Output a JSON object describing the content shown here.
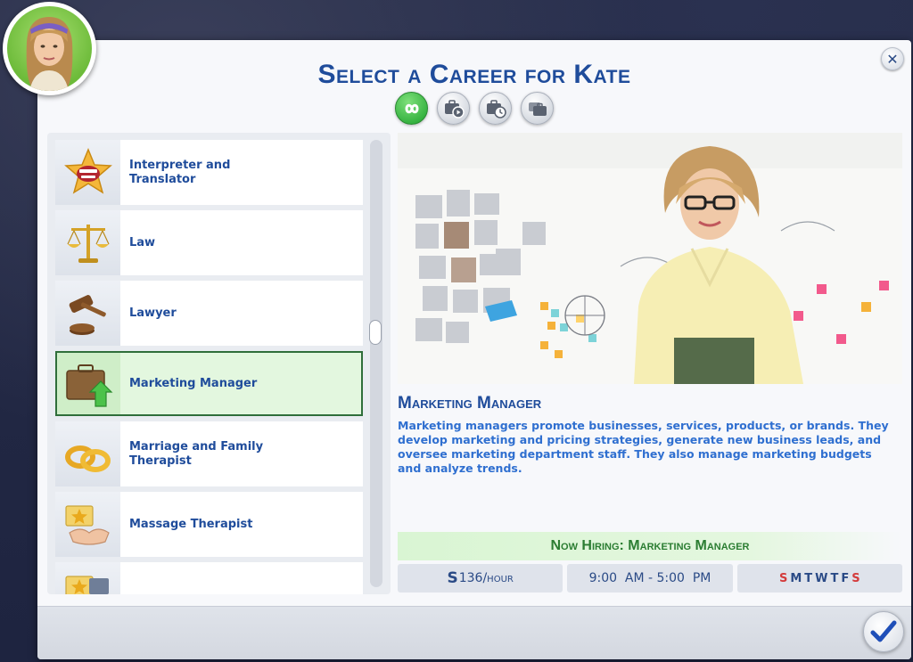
{
  "dialog": {
    "title": "Select a Career for Kate",
    "close_icon": "close-icon",
    "confirm_icon": "checkmark-icon"
  },
  "avatar": {
    "name": "Kate",
    "icon": "sim-portrait"
  },
  "filters": [
    {
      "name": "all-careers",
      "icon": "infinity-icon",
      "active": true
    },
    {
      "name": "active-careers",
      "icon": "briefcase-play-icon",
      "active": false
    },
    {
      "name": "part-time",
      "icon": "briefcase-clock-icon",
      "active": false
    },
    {
      "name": "freelance",
      "icon": "briefcase-stack-icon",
      "active": false
    }
  ],
  "careers": [
    {
      "label": "Interpreter and Translator",
      "icon": "star-mouth-icon"
    },
    {
      "label": "Law",
      "icon": "scales-icon"
    },
    {
      "label": "Lawyer",
      "icon": "gavel-icon"
    },
    {
      "label": "Marketing Manager",
      "icon": "briefcase-arrow-icon",
      "selected": true
    },
    {
      "label": "Marriage and Family Therapist",
      "icon": "rings-icon"
    },
    {
      "label": "Massage Therapist",
      "icon": "hands-star-icon"
    }
  ],
  "detail": {
    "title": "Marketing Manager",
    "description": "Marketing managers promote businesses, services, products, or brands. They develop marketing and pricing strategies, generate new business leads, and oversee marketing department staff. They also manage marketing budgets and analyze trends.",
    "hiring": "Now Hiring: Marketing Manager",
    "pay_symbol": "S",
    "pay_rate": "136/hour",
    "hours": "9:00  AM - 5:00  PM",
    "days": [
      {
        "letter": "S",
        "off": true
      },
      {
        "letter": "M",
        "off": false
      },
      {
        "letter": "T",
        "off": false
      },
      {
        "letter": "W",
        "off": false
      },
      {
        "letter": "T",
        "off": false
      },
      {
        "letter": "F",
        "off": false
      },
      {
        "letter": "S",
        "off": true
      }
    ]
  },
  "colors": {
    "title_blue": "#1f4c9b",
    "desc_blue": "#2f6fd0",
    "hiring_green": "#2b7d32",
    "selected_border": "#2f6e3a",
    "off_day_red": "#d43b3b"
  }
}
